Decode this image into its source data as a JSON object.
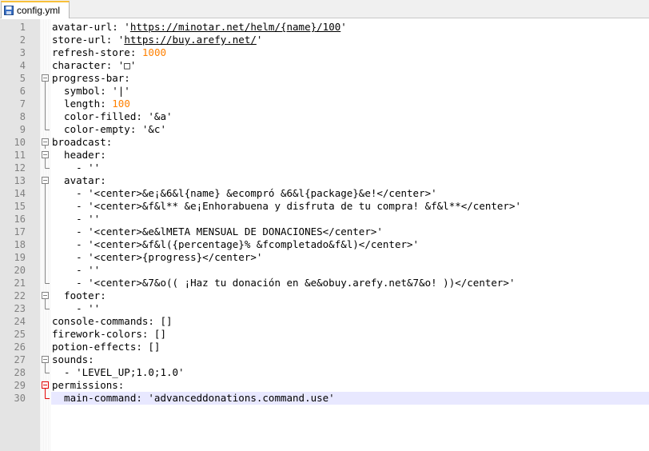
{
  "window": {
    "tab_label": "config.yml",
    "tab_icon": "file-save-icon"
  },
  "editor": {
    "current_line": 30,
    "lines": [
      {
        "n": "1",
        "fold": "",
        "segs": [
          {
            "t": "avatar-url: '"
          },
          {
            "t": "https://minotar.net/helm/{name}/100",
            "c": "url"
          },
          {
            "t": "'"
          }
        ]
      },
      {
        "n": "2",
        "fold": "",
        "segs": [
          {
            "t": "store-url: '"
          },
          {
            "t": "https://buy.arefy.net/",
            "c": "url"
          },
          {
            "t": "'"
          }
        ]
      },
      {
        "n": "3",
        "fold": "",
        "segs": [
          {
            "t": "refresh-store: "
          },
          {
            "t": "1000",
            "c": "num"
          }
        ]
      },
      {
        "n": "4",
        "fold": "",
        "segs": [
          {
            "t": "character: '□'"
          }
        ]
      },
      {
        "n": "5",
        "fold": "start",
        "segs": [
          {
            "t": "progress-bar:"
          }
        ]
      },
      {
        "n": "6",
        "fold": "mid",
        "segs": [
          {
            "t": "  symbol: '|'"
          }
        ]
      },
      {
        "n": "7",
        "fold": "mid",
        "segs": [
          {
            "t": "  length: "
          },
          {
            "t": "100",
            "c": "num"
          }
        ]
      },
      {
        "n": "8",
        "fold": "mid",
        "segs": [
          {
            "t": "  color-filled: '&a'"
          }
        ]
      },
      {
        "n": "9",
        "fold": "end",
        "segs": [
          {
            "t": "  color-empty: '&c'"
          }
        ]
      },
      {
        "n": "10",
        "fold": "start",
        "segs": [
          {
            "t": "broadcast:"
          }
        ]
      },
      {
        "n": "11",
        "fold": "start",
        "segs": [
          {
            "t": "  header:"
          }
        ]
      },
      {
        "n": "12",
        "fold": "end",
        "segs": [
          {
            "t": "    - ''"
          }
        ]
      },
      {
        "n": "13",
        "fold": "start",
        "segs": [
          {
            "t": "  avatar:"
          }
        ]
      },
      {
        "n": "14",
        "fold": "mid",
        "segs": [
          {
            "t": "    - '<center>&e¡&6&l{name} &ecompró &6&l{package}&e!</center>'"
          }
        ]
      },
      {
        "n": "15",
        "fold": "mid",
        "segs": [
          {
            "t": "    - '<center>&f&l** &e¡Enhorabuena y disfruta de tu compra! &f&l**</center>'"
          }
        ]
      },
      {
        "n": "16",
        "fold": "mid",
        "segs": [
          {
            "t": "    - ''"
          }
        ]
      },
      {
        "n": "17",
        "fold": "mid",
        "segs": [
          {
            "t": "    - '<center>&e&lMETA MENSUAL DE DONACIONES</center>'"
          }
        ]
      },
      {
        "n": "18",
        "fold": "mid",
        "segs": [
          {
            "t": "    - '<center>&f&l({percentage}% &fcompletado&f&l)</center>'"
          }
        ]
      },
      {
        "n": "19",
        "fold": "mid",
        "segs": [
          {
            "t": "    - '<center>{progress}</center>'"
          }
        ]
      },
      {
        "n": "20",
        "fold": "mid",
        "segs": [
          {
            "t": "    - ''"
          }
        ]
      },
      {
        "n": "21",
        "fold": "end",
        "segs": [
          {
            "t": "    - '<center>&7&o(( ¡Haz tu donación en &e&obuy.arefy.net&7&o! ))</center>'"
          }
        ]
      },
      {
        "n": "22",
        "fold": "start",
        "segs": [
          {
            "t": "  footer:"
          }
        ]
      },
      {
        "n": "23",
        "fold": "end",
        "segs": [
          {
            "t": "    - ''"
          }
        ]
      },
      {
        "n": "24",
        "fold": "",
        "segs": [
          {
            "t": "console-commands: []"
          }
        ]
      },
      {
        "n": "25",
        "fold": "",
        "segs": [
          {
            "t": "firework-colors: []"
          }
        ]
      },
      {
        "n": "26",
        "fold": "",
        "segs": [
          {
            "t": "potion-effects: []"
          }
        ]
      },
      {
        "n": "27",
        "fold": "start",
        "segs": [
          {
            "t": "sounds:"
          }
        ]
      },
      {
        "n": "28",
        "fold": "end",
        "segs": [
          {
            "t": "  - 'LEVEL_UP;1.0;1.0'"
          }
        ]
      },
      {
        "n": "29",
        "fold": "start-active",
        "segs": [
          {
            "t": "permissions:"
          }
        ]
      },
      {
        "n": "30",
        "fold": "end-active",
        "segs": [
          {
            "t": "  main-command: 'advanceddonations.command.use'"
          }
        ]
      }
    ]
  },
  "colors": {
    "number": "#ff8000",
    "fold_normal": "#808080",
    "fold_active": "#e00000",
    "current_line_bg": "#e8e8ff",
    "gutter_bg": "#e4e4e4"
  }
}
